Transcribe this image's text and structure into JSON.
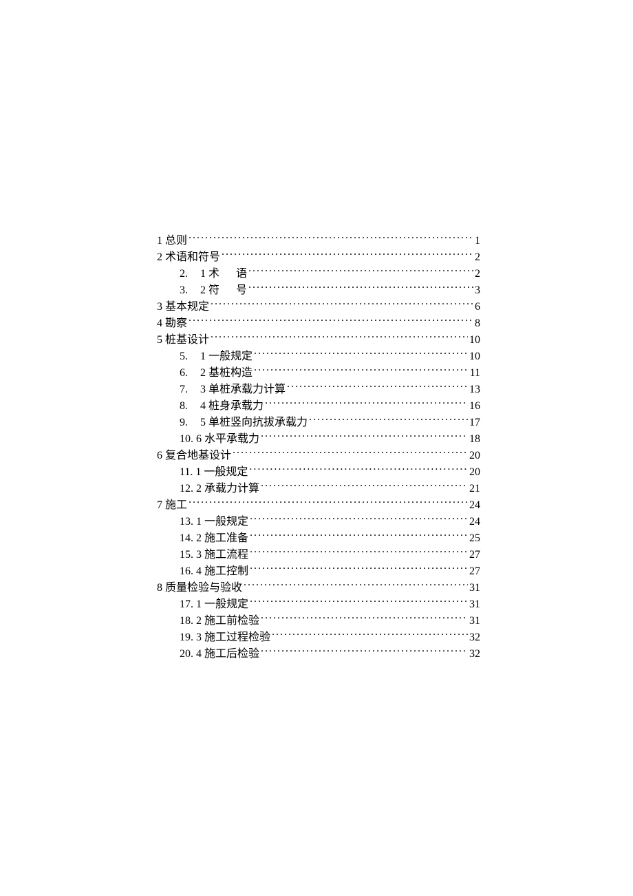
{
  "toc": [
    {
      "level": 1,
      "label": "1 总则",
      "page": "1"
    },
    {
      "level": 1,
      "label": "2 术语和符号",
      "page": "2"
    },
    {
      "level": 2,
      "prefix": "2.",
      "sub": "1",
      "title_spaced": "术语",
      "page": "2"
    },
    {
      "level": 2,
      "prefix": "3.",
      "sub": "2",
      "title_spaced": "符号",
      "page": "3"
    },
    {
      "level": 1,
      "label": "3 基本规定",
      "page": "6"
    },
    {
      "level": 1,
      "label": "4 勘察",
      "page": "8"
    },
    {
      "level": 1,
      "label": "5 桩基设计",
      "page": "10"
    },
    {
      "level": 2,
      "prefix": "5.",
      "sub": "1",
      "title": "一般规定",
      "page": "10",
      "gap": true
    },
    {
      "level": 2,
      "prefix": "6.",
      "sub": "2",
      "title": "基桩构造",
      "page": "11"
    },
    {
      "level": 2,
      "prefix": "7.",
      "sub": "3",
      "title": "单桩承载力计算",
      "page": "13"
    },
    {
      "level": 2,
      "prefix": "8.",
      "sub": "4",
      "title": "桩身承载力",
      "page": "16"
    },
    {
      "level": 2,
      "prefix": "9.",
      "sub": "5",
      "title": "单桩竖向抗拔承载力",
      "page": "17"
    },
    {
      "level": 2,
      "prefix": "10.",
      "sub": "6",
      "title": "水平承载力",
      "page": "18",
      "tight": true
    },
    {
      "level": 1,
      "label": "6 复合地基设计",
      "page": "20"
    },
    {
      "level": 2,
      "prefix": "11.",
      "sub": "1",
      "title": "一般规定",
      "page": "20",
      "tight": true,
      "gap": true
    },
    {
      "level": 2,
      "prefix": "12.",
      "sub": "2",
      "title": "承载力计算",
      "page": "21",
      "tight": true
    },
    {
      "level": 1,
      "label": "7 施工",
      "page": "24"
    },
    {
      "level": 2,
      "prefix": "13.",
      "sub": "1",
      "title": "一般规定",
      "page": "24",
      "tight": true,
      "gap": true
    },
    {
      "level": 2,
      "prefix": "14.",
      "sub": "2",
      "title": "施工准备",
      "page": "25",
      "tight": true,
      "gap": true
    },
    {
      "level": 2,
      "prefix": "15.",
      "sub": "3",
      "title": "施工流程",
      "page": "27",
      "tight": true
    },
    {
      "level": 2,
      "prefix": "16.",
      "sub": "4",
      "title": "施工控制",
      "page": "27",
      "tight": true,
      "gap": true
    },
    {
      "level": 1,
      "label": "8 质量检验与验收",
      "page": "31"
    },
    {
      "level": 2,
      "prefix": "17.",
      "sub": "1",
      "title": "一般规定",
      "page": "31",
      "tight": true,
      "gap": true
    },
    {
      "level": 2,
      "prefix": "18.",
      "sub": "2",
      "title": "施工前检验",
      "page": "31",
      "tight": true
    },
    {
      "level": 2,
      "prefix": "19.",
      "sub": "3",
      "title": "施工过程检验",
      "page": "32",
      "tight": true
    },
    {
      "level": 2,
      "prefix": "20.",
      "sub": "4",
      "title": "施工后检验",
      "page": "32",
      "tight": true
    }
  ]
}
